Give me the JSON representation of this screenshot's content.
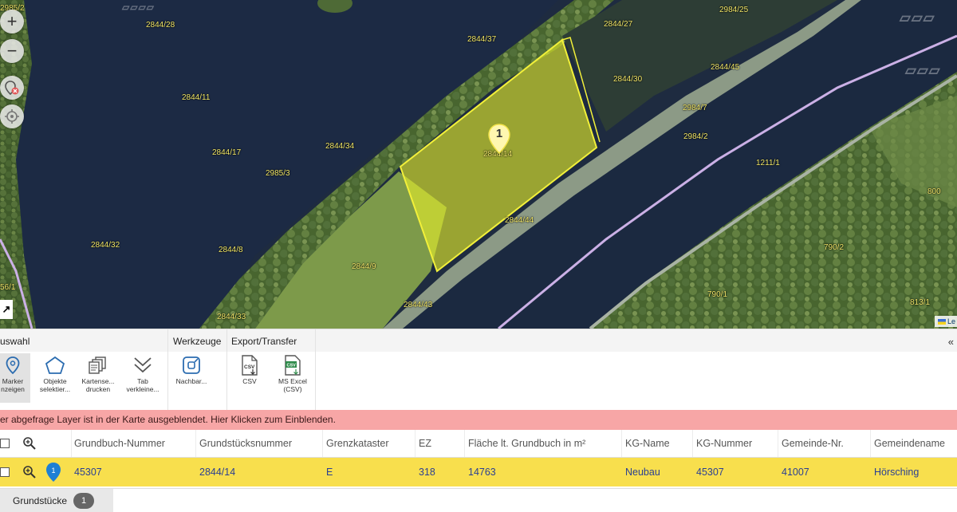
{
  "map": {
    "parcel_labels": [
      {
        "text": "2844/28"
      },
      {
        "text": "2844/37"
      },
      {
        "text": "2844/27"
      },
      {
        "text": "2984/25"
      },
      {
        "text": "2844/45"
      },
      {
        "text": "2844/30"
      },
      {
        "text": "2984/7"
      },
      {
        "text": "2984/2"
      },
      {
        "text": "2844/11"
      },
      {
        "text": "2844/17"
      },
      {
        "text": "2844/34"
      },
      {
        "text": "2985/3"
      },
      {
        "text": "2844/14"
      },
      {
        "text": "1211/1"
      },
      {
        "text": "800"
      },
      {
        "text": "2844/44"
      },
      {
        "text": "2844/32"
      },
      {
        "text": "2844/8"
      },
      {
        "text": "2844/9"
      },
      {
        "text": "790/2"
      },
      {
        "text": "2844/43"
      },
      {
        "text": "790/1"
      },
      {
        "text": "813/1"
      },
      {
        "text": "2844/33"
      },
      {
        "text": "2985/2"
      },
      {
        "text": "56/1"
      }
    ],
    "marker_number": "1",
    "zoom_in_icon": "plus-icon",
    "zoom_out_icon": "minus-icon",
    "attribution_text": "Le",
    "colors": {
      "highlight_fill": "#e6ef2a",
      "highlight_stroke": "#f2f03a",
      "boundary_line": "#c9a8e0"
    }
  },
  "toolbar": {
    "groups": [
      {
        "title": "uswahl"
      },
      {
        "title": "Werkzeuge"
      },
      {
        "title": "Export/Transfer"
      }
    ],
    "tools": {
      "marker": {
        "label1": "Marker",
        "label2": "nzeigen",
        "icon": "map-pin-icon"
      },
      "objects": {
        "label1": "Objekte",
        "label2": "selektier...",
        "icon": "polygon-icon"
      },
      "print": {
        "label1": "Kartense...",
        "label2": "drucken",
        "icon": "print-maps-icon"
      },
      "shrink": {
        "label1": "Tab",
        "label2": "verkleine...",
        "icon": "double-chevron-down-icon"
      },
      "neighbor": {
        "label1": "Nachbar...",
        "label2": "",
        "icon": "neighbor-select-icon"
      },
      "csv": {
        "label1": "CSV",
        "label2": "",
        "icon": "csv-file-icon"
      },
      "excel": {
        "label1": "MS Excel",
        "label2": "(CSV)",
        "icon": "excel-csv-icon"
      }
    },
    "collapse_label": "«"
  },
  "message": {
    "text": "er abgefrage Layer ist in der Karte ausgeblendet. Hier Klicken zum Einblenden.",
    "color": "#f7a6a6"
  },
  "table": {
    "headers": [
      "Grundbuch-Nummer",
      "Grundstücksnummer",
      "Grenzkataster",
      "EZ",
      "Fläche lt. Grundbuch in m²",
      "KG-Name",
      "KG-Nummer",
      "Gemeinde-Nr.",
      "Gemeindename"
    ],
    "rows": [
      {
        "marker_number": "1",
        "cells": [
          "45307",
          "2844/14",
          "E",
          "318",
          "14763",
          "Neubau",
          "45307",
          "41007",
          "Hörsching"
        ]
      }
    ],
    "row_highlight_color": "#f8df4d"
  },
  "bottom_tabs": [
    {
      "label": "Grundstücke",
      "count": "1"
    }
  ]
}
